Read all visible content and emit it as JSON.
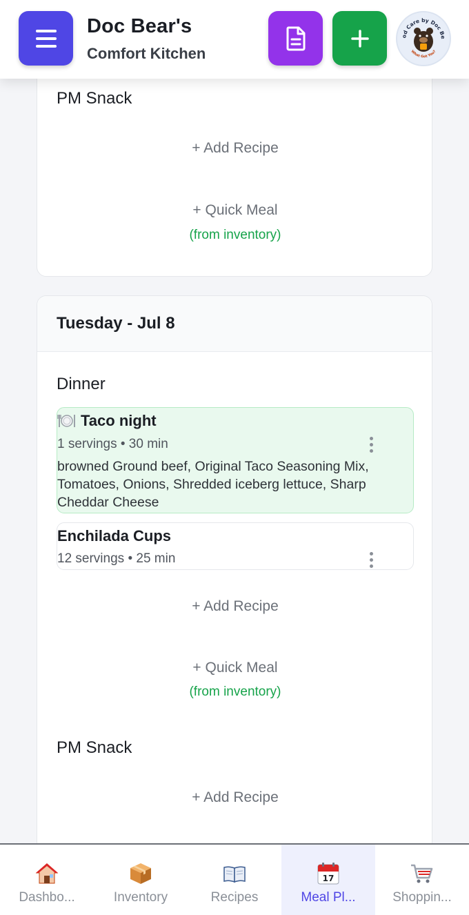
{
  "header": {
    "title": "Doc Bear's",
    "subtitle": "Comfort Kitchen",
    "logo_text_top": "Food Care by Doc Bear",
    "logo_text_bottom": "What Got You?"
  },
  "top_card": {
    "slot_title": "PM Snack",
    "add_recipe": "+ Add Recipe",
    "quick_meal": "+ Quick Meal",
    "quick_meal_note": "(from inventory)"
  },
  "day_card": {
    "day_title": "Tuesday - Jul 8",
    "dinner": {
      "slot_title": "Dinner",
      "recipes": [
        {
          "name": "Taco night",
          "icon": "plate-icon",
          "meta": "1 servings • 30 min",
          "ingredients": "browned Ground beef, Original Taco Seasoning Mix, Tomatoes, Onions, Shredded iceberg lettuce, Sharp Cheddar Cheese"
        },
        {
          "name": "Enchilada Cups",
          "meta": "12 servings • 25 min"
        }
      ],
      "add_recipe": "+ Add Recipe",
      "quick_meal": "+ Quick Meal",
      "quick_meal_note": "(from inventory)"
    },
    "pm_snack": {
      "slot_title": "PM Snack",
      "add_recipe": "+ Add Recipe"
    }
  },
  "bottom_nav": {
    "items": [
      {
        "label": "Dashbo...",
        "icon": "house-icon"
      },
      {
        "label": "Inventory",
        "icon": "box-icon"
      },
      {
        "label": "Recipes",
        "icon": "book-icon"
      },
      {
        "label": "Meal Pl...",
        "icon": "calendar-icon",
        "calendar_day": "17",
        "active": true
      },
      {
        "label": "Shoppin...",
        "icon": "cart-icon"
      }
    ]
  },
  "colors": {
    "menu_button": "#4f46e5",
    "doc_button": "#9333ea",
    "add_button": "#16a34a",
    "active_nav": "#4f46e5",
    "inventory_note": "#16a34a"
  }
}
